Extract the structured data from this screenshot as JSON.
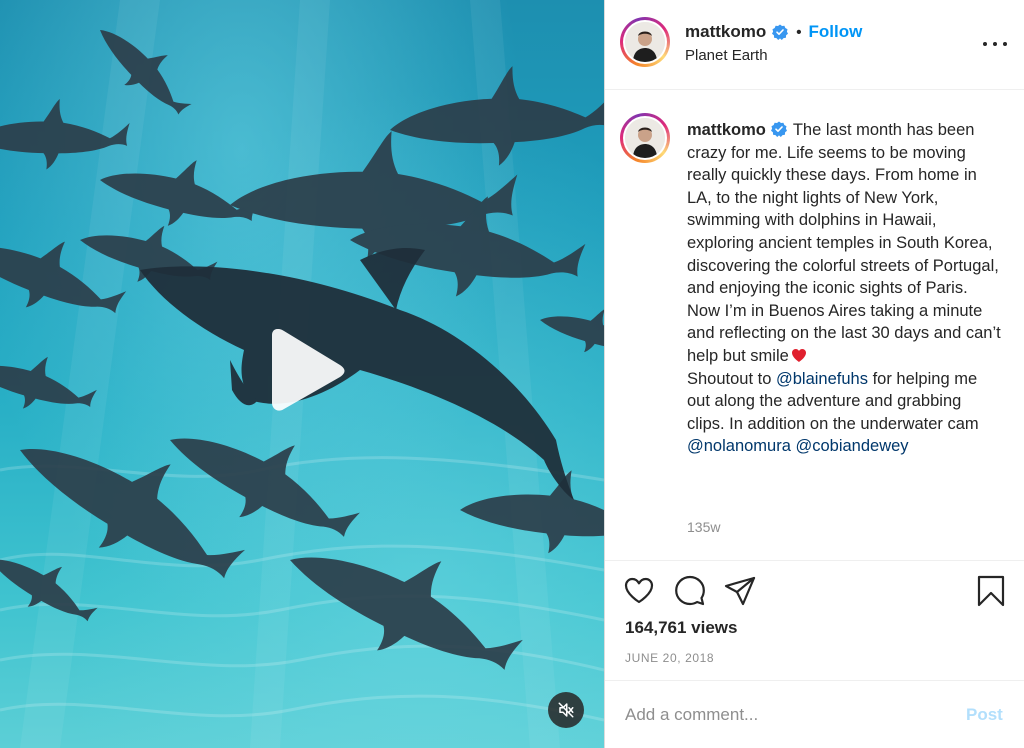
{
  "post": {
    "username": "mattkomo",
    "follow_label": "Follow",
    "separator": "•",
    "location": "Planet Earth",
    "caption_parts": {
      "p1": "The last month has been crazy for me. Life seems to be moving really quickly these days. From home in LA, to the night lights of New York, swimming with dolphins in Hawaii, exploring ancient temples in South Korea, discovering the colorful streets of Portugal, and enjoying the iconic sights of Paris. Now I’m in Buenos Aires taking a minute and reflecting on the last 30 days and can’t help but smile",
      "p2": "Shoutout to",
      "mention1": "@blainefuhs",
      "p3": "for helping me out along the adventure and grabbing clips. In addition on the underwater cam",
      "mention2": "@nolanomura",
      "mention3": "@cobiandewey"
    },
    "comment_time": "135w",
    "views": "164,761 views",
    "date": "JUNE 20, 2018"
  },
  "comment_box": {
    "placeholder": "Add a comment...",
    "post_label": "Post"
  },
  "icons": {
    "verified": "verified-badge-icon",
    "like": "heart-outline-icon",
    "comment": "speech-bubble-icon",
    "share": "paper-plane-icon",
    "save": "bookmark-icon",
    "play": "play-icon",
    "mute": "muted-speaker-icon"
  },
  "colors": {
    "link": "#0095f6",
    "mention": "#00376b",
    "muted_text": "#8e8e8e",
    "post_disabled": "#b2dffc",
    "heart_emoji": "#e0202e"
  }
}
